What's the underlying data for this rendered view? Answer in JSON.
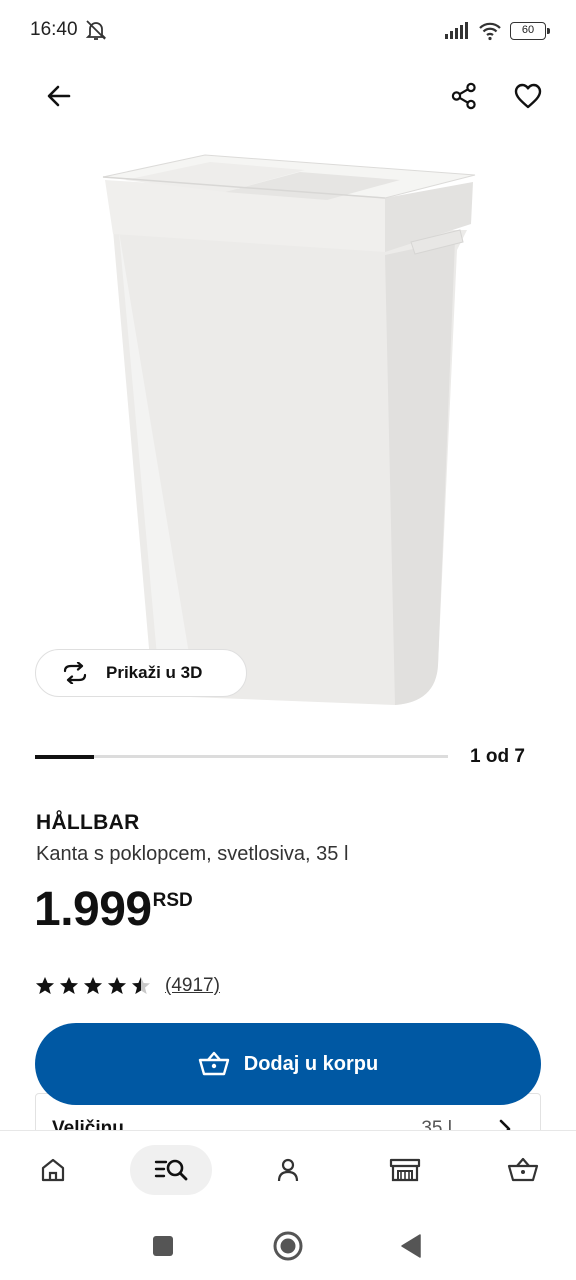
{
  "status_bar": {
    "time": "16:40",
    "battery": "60"
  },
  "product": {
    "name": "HÅLLBAR",
    "description": "Kanta s poklopcem, svetlosiva, 35 l",
    "price": "1.999",
    "currency": "RSD",
    "rating": 4.5,
    "review_count": "(4917)"
  },
  "gallery": {
    "view_3d_label": "Prikaži u 3D",
    "page_indicator": "1 od 7",
    "current_index": 1,
    "total": 7
  },
  "actions": {
    "add_to_cart_label": "Dodaj u korpu"
  },
  "size_option": {
    "label": "Veličinu",
    "value": "35 l"
  },
  "bottom_nav": {
    "items": [
      {
        "icon": "home-icon",
        "active": false
      },
      {
        "icon": "search-list-icon",
        "active": true
      },
      {
        "icon": "profile-icon",
        "active": false
      },
      {
        "icon": "store-icon",
        "active": false
      },
      {
        "icon": "basket-icon",
        "active": false
      }
    ]
  },
  "colors": {
    "accent": "#0058a3",
    "text": "#111111"
  }
}
